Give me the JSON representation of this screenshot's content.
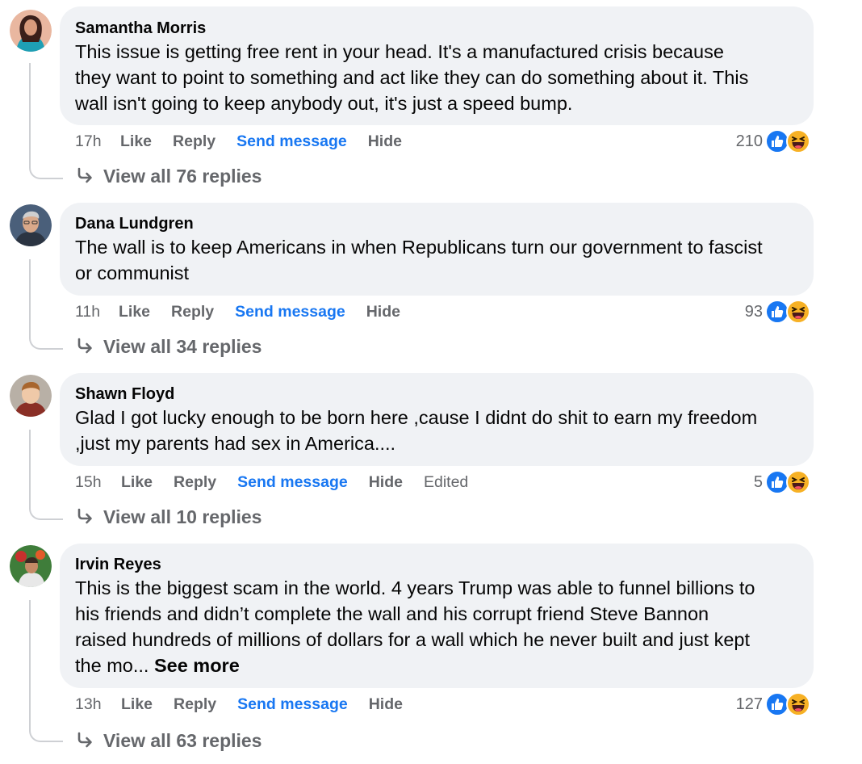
{
  "comments": [
    {
      "author": "Samantha Morris",
      "lines": [
        "This issue is getting free rent in your head. It's a manufactured crisis because",
        "they want to point to something and act like they can do something about it. This",
        "wall isn't going to keep anybody out, it's just a speed bump."
      ],
      "time": "17h",
      "like": "Like",
      "reply": "Reply",
      "send_message": "Send message",
      "hide": "Hide",
      "reaction_count": "210",
      "view_replies": "View all 76 replies"
    },
    {
      "author": "Dana Lundgren",
      "lines": [
        "The wall is to keep Americans in when Republicans turn our government to fascist",
        "or communist"
      ],
      "time": "11h",
      "like": "Like",
      "reply": "Reply",
      "send_message": "Send message",
      "hide": "Hide",
      "reaction_count": "93",
      "view_replies": "View all 34 replies"
    },
    {
      "author": "Shawn Floyd",
      "lines": [
        "Glad I got lucky enough to be born here ,cause I didnt do shit to earn my freedom",
        ",just my parents had sex in America...."
      ],
      "time": "15h",
      "like": "Like",
      "reply": "Reply",
      "send_message": "Send message",
      "hide": "Hide",
      "edited": "Edited",
      "reaction_count": "5",
      "view_replies": "View all 10 replies"
    },
    {
      "author": "Irvin Reyes",
      "lines": [
        "This is the biggest scam in the world. 4 years Trump was able to funnel billions to",
        "his friends and didn’t complete the wall and his corrupt friend Steve Bannon",
        "raised hundreds of millions of dollars for a wall which he never built and just kept",
        "the mo..."
      ],
      "see_more": "See more",
      "time": "13h",
      "like": "Like",
      "reply": "Reply",
      "send_message": "Send message",
      "hide": "Hide",
      "reaction_count": "127",
      "view_replies": "View all 63 replies"
    }
  ],
  "icons": {
    "reply_arrow": "reply-arrow-icon",
    "like_reaction": "like-reaction-icon",
    "haha_reaction": "haha-reaction-icon"
  },
  "colors": {
    "bubble": "#f0f2f5",
    "link_blue": "#1877f2",
    "secondary_text": "#65676b",
    "like_blue": "#1877f2",
    "haha_yellow": "#f7b125"
  }
}
